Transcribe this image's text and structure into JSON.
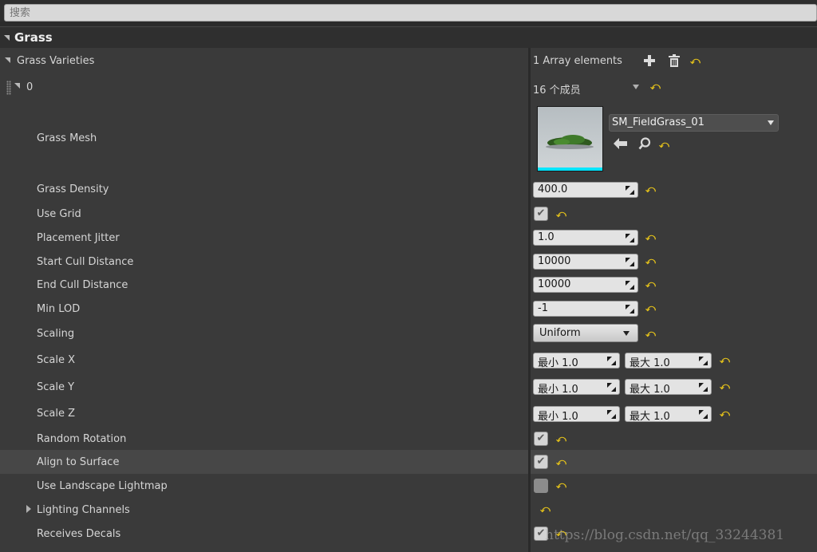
{
  "search": {
    "placeholder": "搜索"
  },
  "category": {
    "title": "Grass"
  },
  "array": {
    "label": "Grass Varieties",
    "count_text": "1 Array elements",
    "add_icon": "plus-icon",
    "delete_icon": "trash-icon"
  },
  "element": {
    "index": "0",
    "members_text": "16 个成员"
  },
  "grass_mesh": {
    "label": "Grass Mesh",
    "asset_name": "SM_FieldGrass_01"
  },
  "properties": {
    "grass_density": {
      "label": "Grass Density",
      "value": "400.0"
    },
    "use_grid": {
      "label": "Use Grid",
      "checked": true
    },
    "placement_jitter": {
      "label": "Placement Jitter",
      "value": "1.0"
    },
    "start_cull_distance": {
      "label": "Start Cull Distance",
      "value": "10000"
    },
    "end_cull_distance": {
      "label": "End Cull Distance",
      "value": "10000"
    },
    "min_lod": {
      "label": "Min LOD",
      "value": "-1"
    },
    "scaling": {
      "label": "Scaling",
      "value": "Uniform"
    },
    "scale_x": {
      "label": "Scale X",
      "min": "最小  1.0",
      "max": "最大  1.0"
    },
    "scale_y": {
      "label": "Scale Y",
      "min": "最小  1.0",
      "max": "最大  1.0"
    },
    "scale_z": {
      "label": "Scale Z",
      "min": "最小  1.0",
      "max": "最大  1.0"
    },
    "random_rotation": {
      "label": "Random Rotation",
      "checked": true
    },
    "align_to_surface": {
      "label": "Align to Surface",
      "checked": true
    },
    "use_landscape_lightmap": {
      "label": "Use Landscape Lightmap",
      "checked": false
    },
    "lighting_channels": {
      "label": "Lighting Channels"
    },
    "receives_decals": {
      "label": "Receives Decals",
      "checked": true
    }
  },
  "watermark": "https://blog.csdn.net/qq_33244381",
  "colors": {
    "reset_arrow": "#e6c31a",
    "thumbnail_underline": "#00e5ff",
    "panel_bg": "#3a3a3a"
  }
}
